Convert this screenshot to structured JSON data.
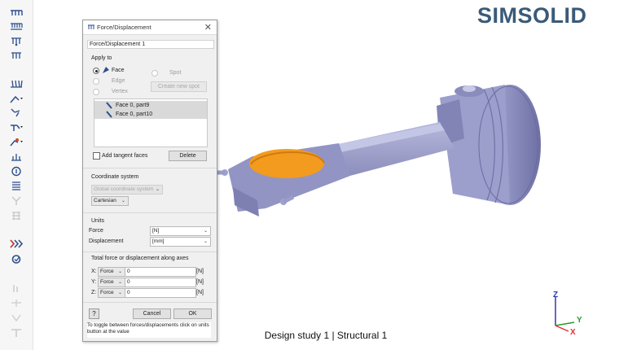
{
  "app": {
    "logo": "SIMSOLID"
  },
  "toolbar": {
    "icons": [
      "force-icon",
      "pressure-icon",
      "gravity-icon",
      "thermal-load-icon",
      "fixed-support-icon",
      "hinge-support-icon",
      "bolt-load-icon",
      "spring-support-icon",
      "bearing-load-icon",
      "info-icon",
      "list-icon",
      "remote-load-icon",
      "grid-icon",
      "solve-icon",
      "settings-icon"
    ]
  },
  "dialog": {
    "title": "Force/Displacement",
    "name_value": "Force/Displacement 1",
    "apply_to_label": "Apply to",
    "face_label": "Face",
    "edge_label": "Edge",
    "vertex_label": "Vertex",
    "spot_label": "Spot",
    "create_spot_label": "Create new spot",
    "list_items": [
      "Face 0, part9",
      "Face 0, part10"
    ],
    "add_tangent_label": "Add tangent faces",
    "delete_label": "Delete",
    "coord_label": "Coordinate system",
    "coord_system_value": "Global coordinate system",
    "coord_type_value": "Cartesian",
    "units_label": "Units",
    "force_label": "Force",
    "force_unit": "[N]",
    "displacement_label": "Displacement",
    "displacement_unit": "[mm]",
    "total_label": "Total force or displacement along axes",
    "axes": [
      {
        "axis": "X:",
        "type": "Force",
        "value": "0",
        "unit": "[N]"
      },
      {
        "axis": "Y:",
        "type": "Force",
        "value": "0",
        "unit": "[N]"
      },
      {
        "axis": "Z:",
        "type": "Force",
        "value": "0",
        "unit": "[N]"
      }
    ],
    "help_label": "?",
    "cancel_label": "Cancel",
    "ok_label": "OK",
    "hint": "To toggle between forces/displacements click on units button at the value"
  },
  "viewport": {
    "footer": "Design study 1 | Structural  1",
    "triad": {
      "z": "Z",
      "y": "Y",
      "x": "X"
    },
    "colors": {
      "model": "#9a9cc8",
      "selected_face": "#f29b1f",
      "axis_x": "#e03030",
      "axis_y": "#2a9a2a",
      "axis_z": "#2a3aa0"
    }
  }
}
